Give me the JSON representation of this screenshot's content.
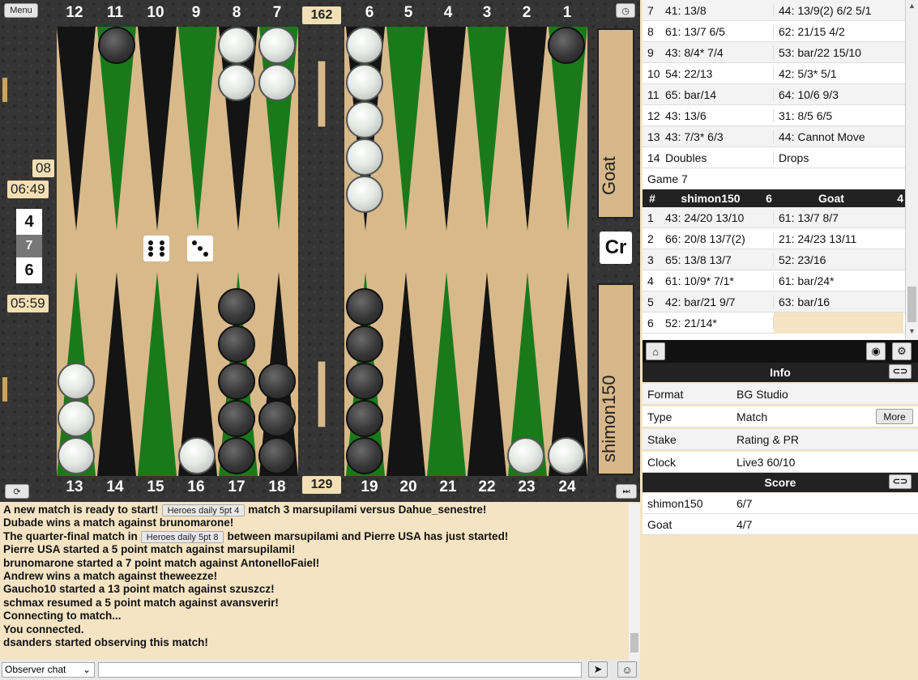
{
  "board": {
    "menu_label": "Menu",
    "top_numbers": [
      "12",
      "11",
      "10",
      "9",
      "8",
      "7",
      "6",
      "5",
      "4",
      "3",
      "2",
      "1"
    ],
    "bottom_numbers": [
      "13",
      "14",
      "15",
      "16",
      "17",
      "18",
      "19",
      "20",
      "21",
      "22",
      "23",
      "24"
    ],
    "pip_top": "162",
    "pip_bottom": "129",
    "match_length": "08",
    "timer_top": "06:49",
    "timer_bottom": "05:59",
    "score_top": "4",
    "score_mid": "7",
    "score_bottom": "6",
    "cube_label": "Cr",
    "tray_top_player": "Goat",
    "tray_bottom_player": "shimon150",
    "dice": [
      6,
      3
    ]
  },
  "history": {
    "prev_rows": [
      [
        "7",
        "41: 13/8",
        "44: 13/9(2) 6/2 5/1"
      ],
      [
        "8",
        "61: 13/7 6/5",
        "62: 21/15 4/2"
      ],
      [
        "9",
        "43: 8/4* 7/4",
        "53: bar/22 15/10"
      ],
      [
        "10",
        "54: 22/13",
        "42: 5/3* 5/1"
      ],
      [
        "11",
        "65: bar/14",
        "64: 10/6 9/3"
      ],
      [
        "12",
        "43: 13/6",
        "31: 8/5 6/5"
      ],
      [
        "13",
        "43: 7/3* 6/3",
        "44: Cannot Move"
      ],
      [
        "14",
        "Doubles",
        "Drops"
      ]
    ],
    "game_label": "Game 7",
    "header": {
      "num": "#",
      "p1": "shimon150",
      "s1": "6",
      "p2": "Goat",
      "s2": "4"
    },
    "rows": [
      [
        "1",
        "43: 24/20 13/10",
        "61: 13/7 8/7"
      ],
      [
        "2",
        "66: 20/8 13/7(2)",
        "21: 24/23 13/11"
      ],
      [
        "3",
        "65: 13/8 13/7",
        "52: 23/16"
      ],
      [
        "4",
        "61: 10/9* 7/1*",
        "61: bar/24*"
      ],
      [
        "5",
        "42: bar/21 9/7",
        "63: bar/16"
      ],
      [
        "6",
        "52: 21/14*",
        ""
      ]
    ]
  },
  "info": {
    "title": "Info",
    "rows": [
      [
        "Format",
        "BG Studio"
      ],
      [
        "Type",
        "Match"
      ],
      [
        "Stake",
        "Rating & PR"
      ],
      [
        "Clock",
        "Live3 60/10"
      ]
    ],
    "more_label": "More"
  },
  "score": {
    "title": "Score",
    "rows": [
      [
        "shimon150",
        "6/7"
      ],
      [
        "Goat",
        "4/7"
      ]
    ]
  },
  "chat": {
    "lines": [
      {
        "pre": "A new match is ready to start!",
        "tag": "Heroes daily 5pt 4",
        "post": "match 3 marsupilami versus Dahue_senestre!"
      },
      {
        "pre": "Dubade wins a match against brunomarone!"
      },
      {
        "pre": "The quarter-final match in",
        "tag": "Heroes daily 5pt 8",
        "post": "between marsupilami and Pierre USA has just started!"
      },
      {
        "pre": "Pierre USA started a 5 point match against marsupilami!"
      },
      {
        "pre": "brunomarone started a 7 point match against AntonelloFaiel!"
      },
      {
        "pre": "Andrew wins a match against theweezze!"
      },
      {
        "pre": "Gaucho10 started a 13 point match against szuszcz!"
      },
      {
        "pre": "schmax resumed a 5 point match against avansverir!"
      },
      {
        "pre": "Connecting to match..."
      },
      {
        "pre": "You connected."
      },
      {
        "pre": "dsanders started observing this match!"
      }
    ],
    "channel": "Observer chat",
    "input_value": ""
  },
  "colors": {
    "green": "#1a7a1a",
    "black_point": "#141414",
    "wood": "#d7b88a"
  }
}
